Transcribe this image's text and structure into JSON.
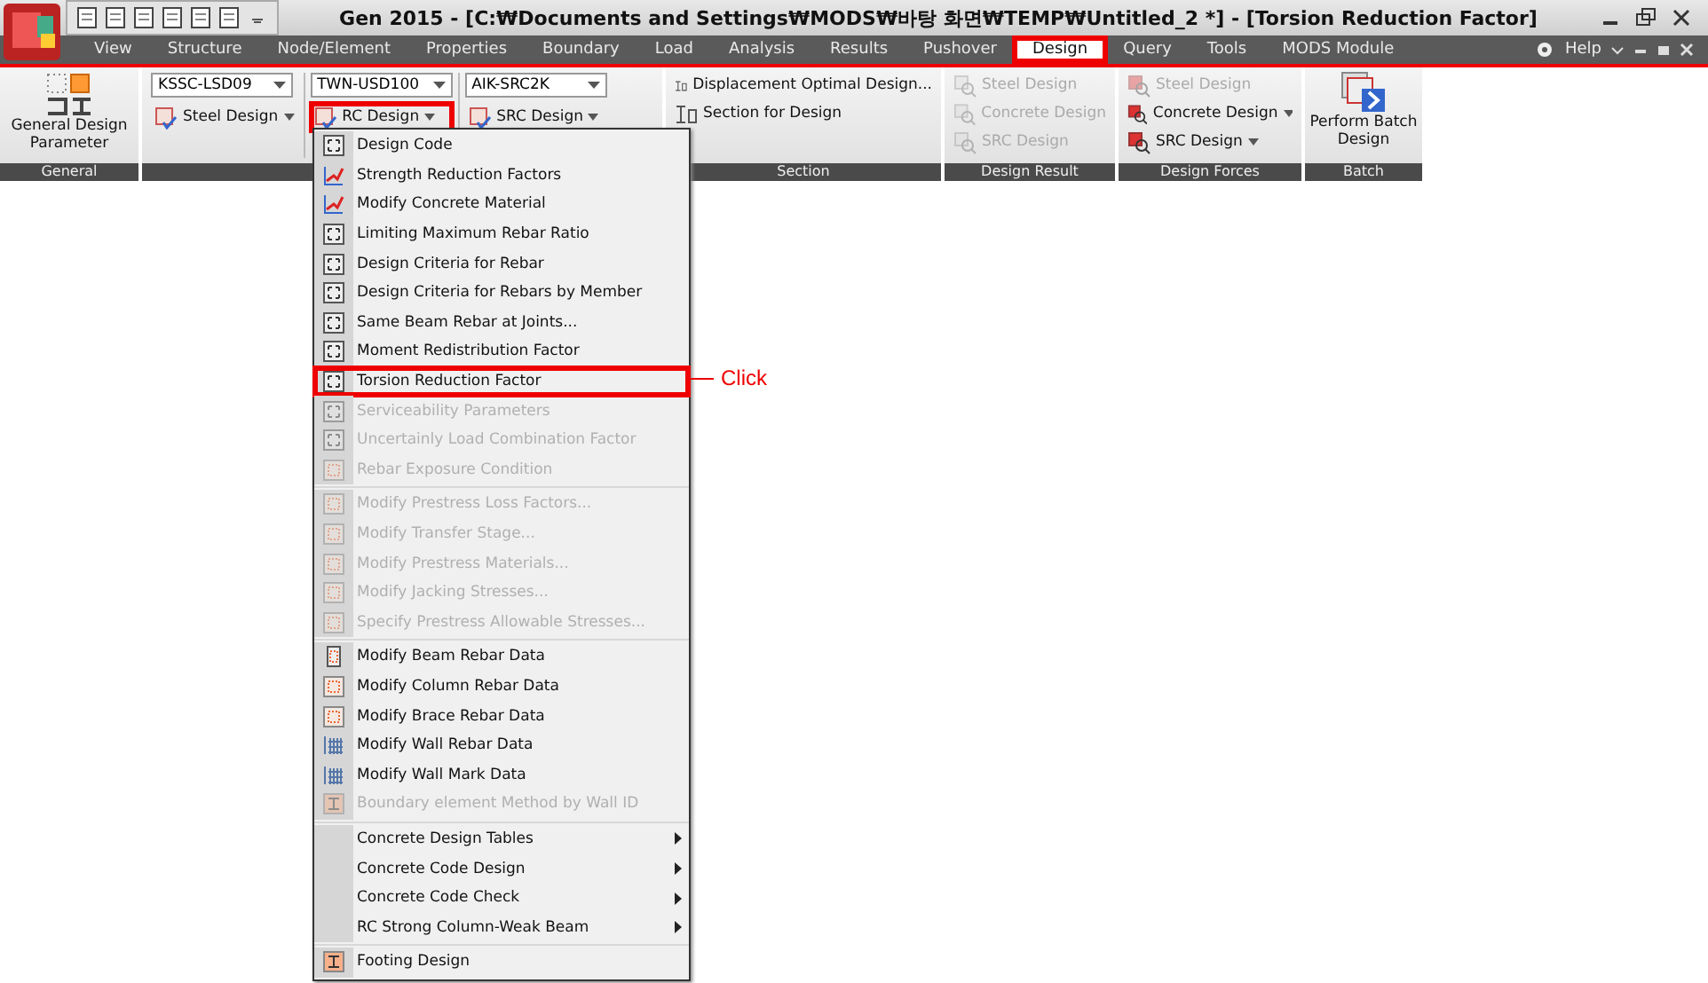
{
  "window": {
    "title": "Gen 2015 - [C:₩Documents and Settings₩MODS₩바탕 화면₩TEMP₩Untitled_2 *] - [Torsion Reduction Factor]"
  },
  "tabs": [
    {
      "label": "View",
      "selected": false
    },
    {
      "label": "Structure",
      "selected": false
    },
    {
      "label": "Node/Element",
      "selected": false
    },
    {
      "label": "Properties",
      "selected": false
    },
    {
      "label": "Boundary",
      "selected": false
    },
    {
      "label": "Load",
      "selected": false
    },
    {
      "label": "Analysis",
      "selected": false
    },
    {
      "label": "Results",
      "selected": false
    },
    {
      "label": "Pushover",
      "selected": false
    },
    {
      "label": "Design",
      "selected": true
    },
    {
      "label": "Query",
      "selected": false
    },
    {
      "label": "Tools",
      "selected": false
    },
    {
      "label": "MODS Module",
      "selected": false
    }
  ],
  "help": "Help",
  "general": {
    "button": "General Design Parameter",
    "label": "General"
  },
  "code_combos": [
    {
      "value": "KSSC-LSD09",
      "button": "Steel Design",
      "highlighted": false
    },
    {
      "value": "TWN-USD100",
      "button": "RC Design",
      "highlighted": true
    },
    {
      "value": "AIK-SRC2K",
      "button": "SRC Design",
      "highlighted": false
    }
  ],
  "section_group": {
    "label": "Section",
    "buttons": [
      "Displacement Optimal Design...",
      "Section for Design"
    ]
  },
  "design_result": {
    "label": "Design Result",
    "buttons": [
      {
        "label": "Steel Design",
        "disabled": true
      },
      {
        "label": "Concrete Design",
        "disabled": true
      },
      {
        "label": "SRC Design",
        "disabled": true
      }
    ]
  },
  "design_forces": {
    "label": "Design Forces",
    "buttons": [
      {
        "label": "Steel Design",
        "disabled": true,
        "dropdown": false
      },
      {
        "label": "Concrete Design",
        "disabled": false,
        "dropdown": true
      },
      {
        "label": "SRC Design",
        "disabled": false,
        "dropdown": true
      }
    ]
  },
  "batch": {
    "label": "Batch",
    "button": "Perform Batch Design"
  },
  "menu": {
    "sections": [
      [
        {
          "kind": "command",
          "label": "Design Code",
          "disabled": false,
          "highlighted": false
        },
        {
          "kind": "command",
          "label": "Strength Reduction Factors",
          "disabled": false,
          "highlighted": false
        },
        {
          "kind": "command",
          "label": "Modify Concrete Material",
          "disabled": false,
          "highlighted": false
        },
        {
          "kind": "command",
          "label": "Limiting Maximum Rebar Ratio",
          "disabled": false,
          "highlighted": false
        },
        {
          "kind": "command",
          "label": "Design Criteria for Rebar",
          "disabled": false,
          "highlighted": false
        },
        {
          "kind": "command",
          "label": "Design Criteria for Rebars by Member",
          "disabled": false,
          "highlighted": false
        },
        {
          "kind": "command",
          "label": "Same Beam Rebar at Joints...",
          "disabled": false,
          "highlighted": false
        },
        {
          "kind": "command",
          "label": "Moment Redistribution Factor",
          "disabled": false,
          "highlighted": false
        },
        {
          "kind": "command",
          "label": "Torsion Reduction Factor",
          "disabled": false,
          "highlighted": true
        },
        {
          "kind": "command",
          "label": "Serviceability Parameters",
          "disabled": true,
          "highlighted": false
        },
        {
          "kind": "command",
          "label": "Uncertainly Load Combination Factor",
          "disabled": true,
          "highlighted": false
        },
        {
          "kind": "command",
          "label": "Rebar Exposure Condition",
          "disabled": true,
          "highlighted": false
        }
      ],
      [
        {
          "kind": "command",
          "label": "Modify Prestress Loss Factors...",
          "disabled": true,
          "highlighted": false
        },
        {
          "kind": "command",
          "label": "Modify Transfer Stage...",
          "disabled": true,
          "highlighted": false
        },
        {
          "kind": "command",
          "label": "Modify Prestress Materials...",
          "disabled": true,
          "highlighted": false
        },
        {
          "kind": "command",
          "label": "Modify Jacking Stresses...",
          "disabled": true,
          "highlighted": false
        },
        {
          "kind": "command",
          "label": "Specify Prestress Allowable Stresses...",
          "disabled": true,
          "highlighted": false
        }
      ],
      [
        {
          "kind": "command",
          "label": "Modify Beam Rebar Data",
          "disabled": false,
          "highlighted": false
        },
        {
          "kind": "command",
          "label": "Modify Column Rebar Data",
          "disabled": false,
          "highlighted": false
        },
        {
          "kind": "command",
          "label": "Modify Brace Rebar Data",
          "disabled": false,
          "highlighted": false
        },
        {
          "kind": "command",
          "label": "Modify Wall Rebar Data",
          "disabled": false,
          "highlighted": false
        },
        {
          "kind": "command",
          "label": "Modify Wall Mark Data",
          "disabled": false,
          "highlighted": false
        },
        {
          "kind": "command",
          "label": "Boundary element Method by Wall ID",
          "disabled": true,
          "highlighted": false
        }
      ],
      [
        {
          "kind": "submenu",
          "label": "Concrete Design Tables"
        },
        {
          "kind": "submenu",
          "label": "Concrete Code Design"
        },
        {
          "kind": "submenu",
          "label": "Concrete Code Check"
        },
        {
          "kind": "submenu",
          "label": "RC Strong Column-Weak Beam"
        }
      ],
      [
        {
          "kind": "command",
          "label": "Footing Design",
          "disabled": false,
          "highlighted": false
        }
      ]
    ]
  },
  "annotation": {
    "label": "Click"
  }
}
